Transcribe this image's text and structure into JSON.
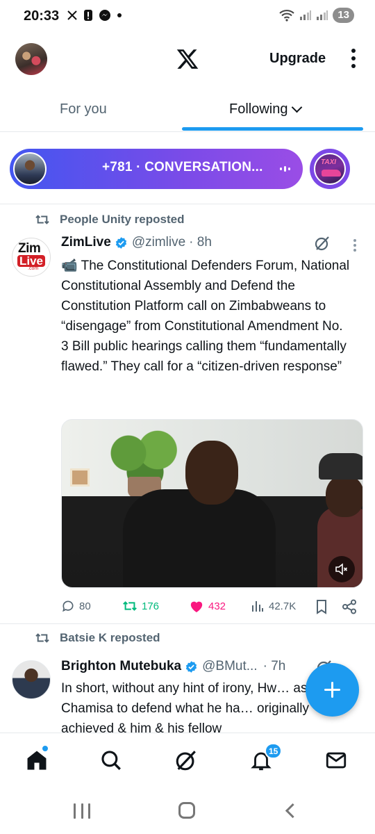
{
  "status_bar": {
    "time": "20:33",
    "battery": "13",
    "left_icons": [
      "x-icon",
      "alert-icon",
      "messenger-icon",
      "dot-icon"
    ],
    "right_icons": [
      "wifi-icon",
      "signal-icon",
      "signal-icon"
    ]
  },
  "header": {
    "upgrade_label": "Upgrade"
  },
  "tabs": {
    "for_you": "For you",
    "following": "Following"
  },
  "spaces": {
    "pill_text": "+781 · CONVERSATION...",
    "second_label": "TAXI"
  },
  "tweets": [
    {
      "repost_by": "People Unity reposted",
      "name": "ZimLive",
      "handle": "@zimlive",
      "time": "· 8h",
      "body": "📹 The Constitutional Defenders Forum, National Constitutional Assembly and Defend the Constitution Platform call on Zimbabweans to “disengage” from Constitutional Amendment No. 3 Bill public hearings calling them “fundamentally flawed.” They call for a “citizen-driven response”",
      "avatar_text": {
        "zim": "Zim",
        "live": "Live",
        "com": ".com"
      },
      "stats": {
        "replies": "80",
        "reposts": "176",
        "likes": "432",
        "views": "42.7K"
      }
    },
    {
      "repost_by": "Batsie K reposted",
      "name": "Brighton Mutebuka",
      "handle": "@BMut...",
      "time": "· 7h",
      "body": "In short, without any hint of irony, Hw… asking Chamisa to defend what he ha… originally achieved & him & his fellow"
    }
  ],
  "bottom_nav": {
    "notifications_count": "15",
    "items": [
      "home-icon",
      "search-icon",
      "grok-icon",
      "notifications-icon",
      "messages-icon"
    ]
  },
  "colors": {
    "accent": "#1d9bf0",
    "repost_green": "#00ba7c",
    "like_pink": "#f91880",
    "secondary_text": "#536471"
  }
}
